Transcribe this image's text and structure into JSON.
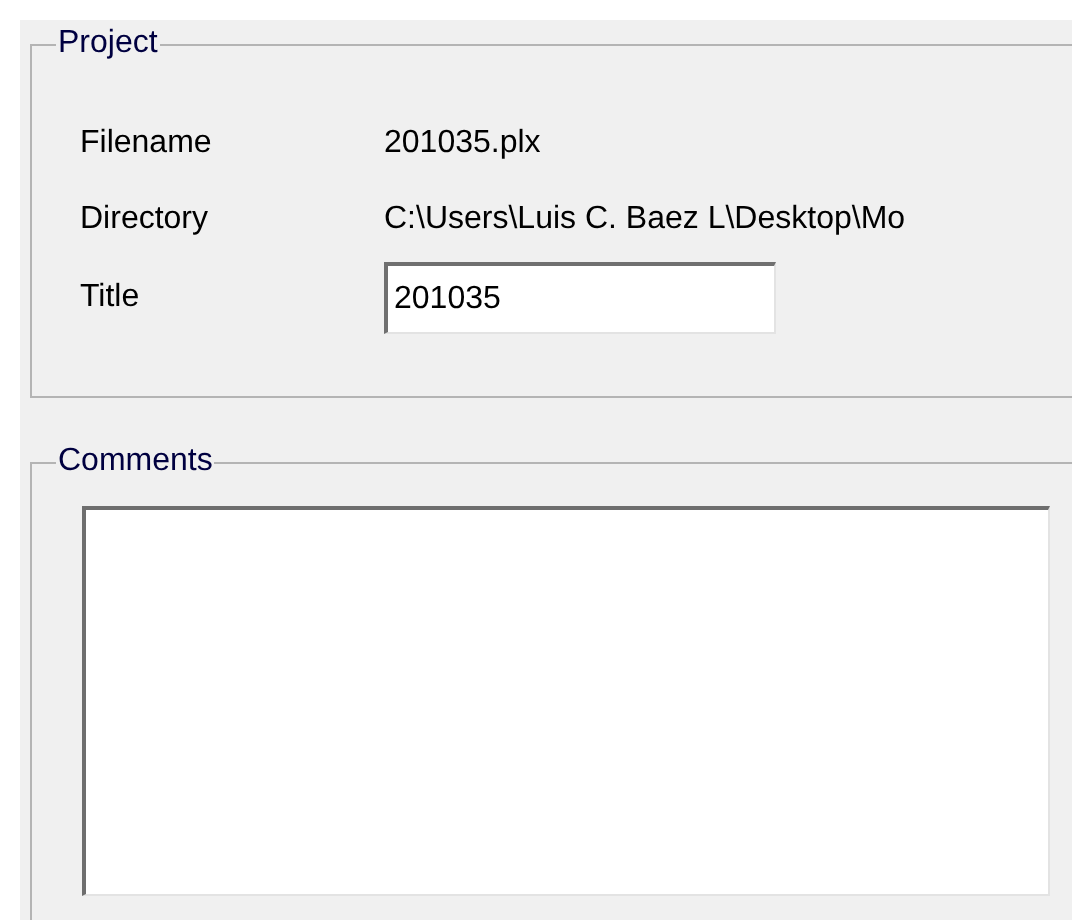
{
  "project": {
    "title": "Project",
    "fields": [
      {
        "kind": "text",
        "label": "Filename",
        "value": "201035.plx"
      },
      {
        "kind": "text",
        "label": "Directory",
        "value": "C:\\Users\\Luis C. Baez L\\Desktop\\Mo"
      },
      {
        "kind": "input",
        "label": "Title",
        "value": "201035"
      }
    ]
  },
  "comments": {
    "title": "Comments"
  }
}
